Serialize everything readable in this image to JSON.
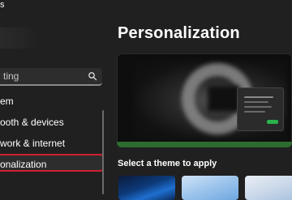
{
  "app": {
    "title": "s"
  },
  "search": {
    "value": "ting"
  },
  "sidebar": {
    "items": [
      {
        "label": "em"
      },
      {
        "label": "ooth & devices"
      },
      {
        "label": "work & internet"
      },
      {
        "label": "onalization",
        "active": true
      }
    ]
  },
  "main": {
    "title": "Personalization",
    "section_label": "Select a theme to apply",
    "accent_color": "#29b34b"
  },
  "themes": [
    {
      "name": "theme-dark-bloom"
    },
    {
      "name": "theme-light-bloom"
    },
    {
      "name": "theme-light"
    }
  ]
}
